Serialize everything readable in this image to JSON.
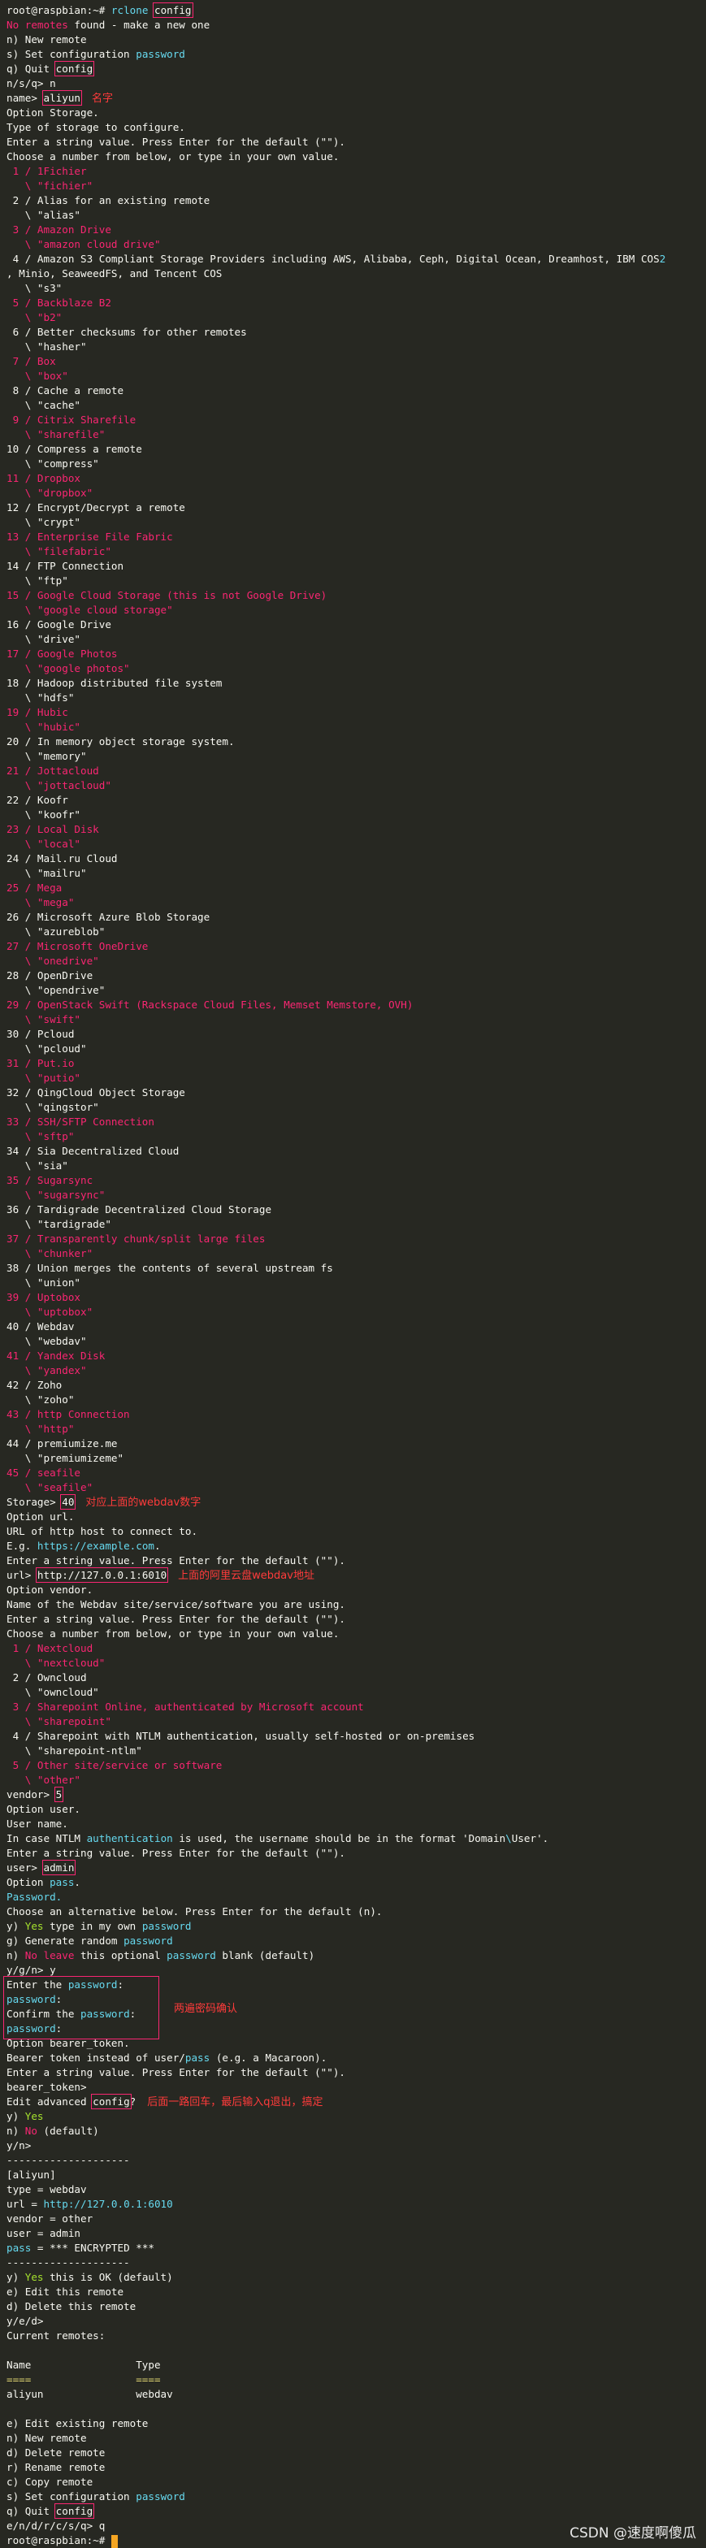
{
  "terminal": {
    "lines": [
      [
        {
          "t": "root@raspbian:~# "
        },
        {
          "t": "rclone",
          "c": "cy"
        },
        {
          "t": " "
        },
        {
          "t": "config",
          "bx": true
        }
      ],
      [
        {
          "t": "No remotes",
          "c": "rd"
        },
        {
          "t": " found - make a new one"
        }
      ],
      [
        {
          "t": "n) New remote"
        }
      ],
      [
        {
          "t": "s) Set configuration "
        },
        {
          "t": "password",
          "c": "cy"
        }
      ],
      [
        {
          "t": "q) Quit "
        },
        {
          "t": "config",
          "bx": true
        }
      ],
      [
        {
          "t": "n/s/q> n"
        }
      ],
      [
        {
          "t": "name> "
        },
        {
          "t": "aliyun",
          "bx": true
        },
        {
          "t": "名字",
          "note": true
        }
      ],
      [
        {
          "t": "Option Storage."
        }
      ],
      [
        {
          "t": "Type of storage to configure."
        }
      ],
      [
        {
          "t": "Enter a string value. Press Enter for the default (\"\")."
        }
      ],
      [
        {
          "t": "Choose a number from below, or type in your own value."
        }
      ],
      [
        {
          "t": " 1 / 1Fichier",
          "c": "rd"
        }
      ],
      [
        {
          "t": "   \\ \"fichier\"",
          "c": "rd"
        }
      ],
      [
        {
          "t": " 2 / Alias for an existing remote"
        }
      ],
      [
        {
          "t": "   \\ \"alias\""
        }
      ],
      [
        {
          "t": " 3 / Amazon Drive",
          "c": "rd"
        }
      ],
      [
        {
          "t": "   \\ \"amazon cloud drive\"",
          "c": "rd"
        }
      ],
      [
        {
          "t": " 4 / Amazon S3 Compliant Storage Providers including AWS, Alibaba, Ceph, Digital Ocean, Dreamhost, IBM COS"
        },
        {
          "t": "2",
          "c": "cy"
        }
      ],
      [
        {
          "t": ", Minio, SeaweedFS, and Tencent COS"
        }
      ],
      [
        {
          "t": "   \\ \"s3\""
        }
      ],
      [
        {
          "t": " 5 / Backblaze B2",
          "c": "rd"
        }
      ],
      [
        {
          "t": "   \\ \"b2\"",
          "c": "rd"
        }
      ],
      [
        {
          "t": " 6 / Better checksums for other remotes"
        }
      ],
      [
        {
          "t": "   \\ \"hasher\""
        }
      ],
      [
        {
          "t": " 7 / Box",
          "c": "rd"
        }
      ],
      [
        {
          "t": "   \\ \"box\"",
          "c": "rd"
        }
      ],
      [
        {
          "t": " 8 / Cache a remote"
        }
      ],
      [
        {
          "t": "   \\ \"cache\""
        }
      ],
      [
        {
          "t": " 9 / Citrix Sharefile",
          "c": "rd"
        }
      ],
      [
        {
          "t": "   \\ \"sharefile\"",
          "c": "rd"
        }
      ],
      [
        {
          "t": "10 / Compress a remote"
        }
      ],
      [
        {
          "t": "   \\ \"compress\""
        }
      ],
      [
        {
          "t": "11 / Dropbox",
          "c": "rd"
        }
      ],
      [
        {
          "t": "   \\ \"dropbox\"",
          "c": "rd"
        }
      ],
      [
        {
          "t": "12 / Encrypt/Decrypt a remote"
        }
      ],
      [
        {
          "t": "   \\ \"crypt\""
        }
      ],
      [
        {
          "t": "13 / Enterprise File Fabric",
          "c": "rd"
        }
      ],
      [
        {
          "t": "   \\ \"filefabric\"",
          "c": "rd"
        }
      ],
      [
        {
          "t": "14 / FTP Connection"
        }
      ],
      [
        {
          "t": "   \\ \"ftp\""
        }
      ],
      [
        {
          "t": "15 / Google Cloud Storage (this is not Google Drive)",
          "c": "rd"
        }
      ],
      [
        {
          "t": "   \\ \"google cloud storage\"",
          "c": "rd"
        }
      ],
      [
        {
          "t": "16 / Google Drive"
        }
      ],
      [
        {
          "t": "   \\ \"drive\""
        }
      ],
      [
        {
          "t": "17 / Google Photos",
          "c": "rd"
        }
      ],
      [
        {
          "t": "   \\ \"google photos\"",
          "c": "rd"
        }
      ],
      [
        {
          "t": "18 / Hadoop distributed file system"
        }
      ],
      [
        {
          "t": "   \\ \"hdfs\""
        }
      ],
      [
        {
          "t": "19 / Hubic",
          "c": "rd"
        }
      ],
      [
        {
          "t": "   \\ \"hubic\"",
          "c": "rd"
        }
      ],
      [
        {
          "t": "20 / In memory object storage system."
        }
      ],
      [
        {
          "t": "   \\ \"memory\""
        }
      ],
      [
        {
          "t": "21 / Jottacloud",
          "c": "rd"
        }
      ],
      [
        {
          "t": "   \\ \"jottacloud\"",
          "c": "rd"
        }
      ],
      [
        {
          "t": "22 / Koofr"
        }
      ],
      [
        {
          "t": "   \\ \"koofr\""
        }
      ],
      [
        {
          "t": "23 / Local Disk",
          "c": "rd"
        }
      ],
      [
        {
          "t": "   \\ \"local\"",
          "c": "rd"
        }
      ],
      [
        {
          "t": "24 / Mail.ru Cloud"
        }
      ],
      [
        {
          "t": "   \\ \"mailru\""
        }
      ],
      [
        {
          "t": "25 / Mega",
          "c": "rd"
        }
      ],
      [
        {
          "t": "   \\ \"mega\"",
          "c": "rd"
        }
      ],
      [
        {
          "t": "26 / Microsoft Azure Blob Storage"
        }
      ],
      [
        {
          "t": "   \\ \"azureblob\""
        }
      ],
      [
        {
          "t": "27 / Microsoft OneDrive",
          "c": "rd"
        }
      ],
      [
        {
          "t": "   \\ \"onedrive\"",
          "c": "rd"
        }
      ],
      [
        {
          "t": "28 / OpenDrive"
        }
      ],
      [
        {
          "t": "   \\ \"opendrive\""
        }
      ],
      [
        {
          "t": "29 / OpenStack Swift (Rackspace Cloud Files, Memset Memstore, OVH)",
          "c": "rd"
        }
      ],
      [
        {
          "t": "   \\ \"swift\"",
          "c": "rd"
        }
      ],
      [
        {
          "t": "30 / Pcloud"
        }
      ],
      [
        {
          "t": "   \\ \"pcloud\""
        }
      ],
      [
        {
          "t": "31 / Put.io",
          "c": "rd"
        }
      ],
      [
        {
          "t": "   \\ \"putio\"",
          "c": "rd"
        }
      ],
      [
        {
          "t": "32 / QingCloud Object Storage"
        }
      ],
      [
        {
          "t": "   \\ \"qingstor\""
        }
      ],
      [
        {
          "t": "33 / SSH/SFTP Connection",
          "c": "rd"
        }
      ],
      [
        {
          "t": "   \\ \"sftp\"",
          "c": "rd"
        }
      ],
      [
        {
          "t": "34 / Sia Decentralized Cloud"
        }
      ],
      [
        {
          "t": "   \\ \"sia\""
        }
      ],
      [
        {
          "t": "35 / Sugarsync",
          "c": "rd"
        }
      ],
      [
        {
          "t": "   \\ \"sugarsync\"",
          "c": "rd"
        }
      ],
      [
        {
          "t": "36 / Tardigrade Decentralized Cloud Storage"
        }
      ],
      [
        {
          "t": "   \\ \"tardigrade\""
        }
      ],
      [
        {
          "t": "37 / Transparently chunk/split large files",
          "c": "rd"
        }
      ],
      [
        {
          "t": "   \\ \"chunker\"",
          "c": "rd"
        }
      ],
      [
        {
          "t": "38 / Union merges the contents of several upstream fs"
        }
      ],
      [
        {
          "t": "   \\ \"union\""
        }
      ],
      [
        {
          "t": "39 / Uptobox",
          "c": "rd"
        }
      ],
      [
        {
          "t": "   \\ \"uptobox\"",
          "c": "rd"
        }
      ],
      [
        {
          "t": "40 / Webdav"
        }
      ],
      [
        {
          "t": "   \\ \"webdav\""
        }
      ],
      [
        {
          "t": "41 / Yandex Disk",
          "c": "rd"
        }
      ],
      [
        {
          "t": "   \\ \"yandex\"",
          "c": "rd"
        }
      ],
      [
        {
          "t": "42 / Zoho"
        }
      ],
      [
        {
          "t": "   \\ \"zoho\""
        }
      ],
      [
        {
          "t": "43 / http Connection",
          "c": "rd"
        }
      ],
      [
        {
          "t": "   \\ \"http\"",
          "c": "rd"
        }
      ],
      [
        {
          "t": "44 / premiumize.me"
        }
      ],
      [
        {
          "t": "   \\ \"premiumizeme\""
        }
      ],
      [
        {
          "t": "45 / seafile",
          "c": "rd"
        }
      ],
      [
        {
          "t": "   \\ \"seafile\"",
          "c": "rd"
        }
      ],
      [
        {
          "t": "Storage> "
        },
        {
          "t": "40",
          "bx": true
        },
        {
          "t": "对应上面的webdav数字",
          "note": true
        }
      ],
      [
        {
          "t": "Option url."
        }
      ],
      [
        {
          "t": "URL of http host to connect to."
        }
      ],
      [
        {
          "t": "E.g. "
        },
        {
          "t": "https://example.com",
          "c": "cy"
        },
        {
          "t": "."
        }
      ],
      [
        {
          "t": "Enter a string value. Press Enter for the default (\"\")."
        }
      ],
      [
        {
          "t": "url> "
        },
        {
          "t": "http://127.0.0.1:6010",
          "bx": true
        },
        {
          "t": "上面的阿里云盘webdav地址",
          "note": true
        }
      ],
      [
        {
          "t": "Option vendor."
        }
      ],
      [
        {
          "t": "Name of the Webdav site/service/software you are using."
        }
      ],
      [
        {
          "t": "Enter a string value. Press Enter for the default (\"\")."
        }
      ],
      [
        {
          "t": "Choose a number from below, or type in your own value."
        }
      ],
      [
        {
          "t": " 1 / Nextcloud",
          "c": "rd"
        }
      ],
      [
        {
          "t": "   \\ \"nextcloud\"",
          "c": "rd"
        }
      ],
      [
        {
          "t": " 2 / Owncloud"
        }
      ],
      [
        {
          "t": "   \\ \"owncloud\""
        }
      ],
      [
        {
          "t": " 3 / Sharepoint Online, authenticated by Microsoft account",
          "c": "rd"
        }
      ],
      [
        {
          "t": "   \\ \"sharepoint\"",
          "c": "rd"
        }
      ],
      [
        {
          "t": " 4 / Sharepoint with NTLM authentication, usually self-hosted or on-premises"
        }
      ],
      [
        {
          "t": "   \\ \"sharepoint-ntlm\""
        }
      ],
      [
        {
          "t": " 5 / Other site/service or software",
          "c": "rd"
        }
      ],
      [
        {
          "t": "   \\ \"other\"",
          "c": "rd"
        }
      ],
      [
        {
          "t": "vendor> "
        },
        {
          "t": "5",
          "bx": true
        }
      ],
      [
        {
          "t": "Option user."
        }
      ],
      [
        {
          "t": "User name."
        }
      ],
      [
        {
          "t": "In case NTLM "
        },
        {
          "t": "authentication",
          "c": "cy"
        },
        {
          "t": " is used, the username should be in the format 'Domain"
        },
        {
          "t": "\\",
          "c": "cy"
        },
        {
          "t": "User'."
        }
      ],
      [
        {
          "t": "Enter a string value. Press Enter for the default (\"\")."
        }
      ],
      [
        {
          "t": "user> "
        },
        {
          "t": "admin",
          "bx": true
        }
      ],
      [
        {
          "t": "Option "
        },
        {
          "t": "pass",
          "c": "cy"
        },
        {
          "t": "."
        }
      ],
      [
        {
          "t": "Password.",
          "c": "cy"
        }
      ],
      [
        {
          "t": "Choose an alternative below. Press Enter for the default (n)."
        }
      ],
      [
        {
          "t": "y) "
        },
        {
          "t": "Yes",
          "c": "gr"
        },
        {
          "t": " type in my own "
        },
        {
          "t": "password",
          "c": "cy"
        }
      ],
      [
        {
          "t": "g) Generate random "
        },
        {
          "t": "password",
          "c": "cy"
        }
      ],
      [
        {
          "t": "n) "
        },
        {
          "t": "No",
          "c": "rd"
        },
        {
          "t": " "
        },
        {
          "t": "leave",
          "c": "rd"
        },
        {
          "t": " this optional "
        },
        {
          "t": "password",
          "c": "cy"
        },
        {
          "t": " blank (default)"
        }
      ],
      [
        {
          "t": "y/g/n> y"
        }
      ],
      [
        {
          "t": "Enter the "
        },
        {
          "t": "password",
          "c": "cy"
        },
        {
          "t": ":"
        }
      ],
      [
        {
          "t": "password",
          "c": "cy"
        },
        {
          "t": ":"
        }
      ],
      [
        {
          "t": "Confirm the "
        },
        {
          "t": "password",
          "c": "cy"
        },
        {
          "t": ":"
        }
      ],
      [
        {
          "t": "password",
          "c": "cy"
        },
        {
          "t": ":"
        }
      ],
      [
        {
          "t": "Option bearer_token."
        }
      ],
      [
        {
          "t": "Bearer token instead of user/"
        },
        {
          "t": "pass",
          "c": "cy"
        },
        {
          "t": " (e.g. a Macaroon)."
        }
      ],
      [
        {
          "t": "Enter a string value. Press Enter for the default (\"\")."
        }
      ],
      [
        {
          "t": "bearer_token>"
        }
      ],
      [
        {
          "t": "Edit advanced "
        },
        {
          "t": "config",
          "bx": true
        },
        {
          "t": "?"
        },
        {
          "t": "后面一路回车，最后输入q退出，搞定",
          "note": true
        }
      ],
      [
        {
          "t": "y) "
        },
        {
          "t": "Yes",
          "c": "gr"
        }
      ],
      [
        {
          "t": "n) "
        },
        {
          "t": "No",
          "c": "rd"
        },
        {
          "t": " (default)"
        }
      ],
      [
        {
          "t": "y/n>"
        }
      ],
      [
        {
          "t": "--------------------"
        }
      ],
      [
        {
          "t": "[aliyun]"
        }
      ],
      [
        {
          "t": "type = webdav"
        }
      ],
      [
        {
          "t": "url = "
        },
        {
          "t": "http://127.0.0.1:6010",
          "c": "cy"
        }
      ],
      [
        {
          "t": "vendor = other"
        }
      ],
      [
        {
          "t": "user = admin"
        }
      ],
      [
        {
          "t": "pass",
          "c": "cy"
        },
        {
          "t": " = *** ENCRYPTED ***"
        }
      ],
      [
        {
          "t": "--------------------"
        }
      ],
      [
        {
          "t": "y) "
        },
        {
          "t": "Yes",
          "c": "gr"
        },
        {
          "t": " this is OK (default)"
        }
      ],
      [
        {
          "t": "e) Edit this remote"
        }
      ],
      [
        {
          "t": "d) Delete this remote"
        }
      ],
      [
        {
          "t": "y/e/d>"
        }
      ],
      [
        {
          "t": "Current remotes:"
        }
      ],
      [
        {
          "t": ""
        }
      ],
      [
        {
          "t": "Name                 Type"
        }
      ],
      [
        {
          "t": "====                 ====",
          "c": "yl"
        }
      ],
      [
        {
          "t": "aliyun               webdav"
        }
      ],
      [
        {
          "t": ""
        }
      ],
      [
        {
          "t": "e) Edit existing remote"
        }
      ],
      [
        {
          "t": "n) New remote"
        }
      ],
      [
        {
          "t": "d) Delete remote"
        }
      ],
      [
        {
          "t": "r) Rename remote"
        }
      ],
      [
        {
          "t": "c) Copy remote"
        }
      ],
      [
        {
          "t": "s) Set configuration "
        },
        {
          "t": "password",
          "c": "cy"
        }
      ],
      [
        {
          "t": "q) Quit "
        },
        {
          "t": "config",
          "bx": true
        }
      ],
      [
        {
          "t": "e/n/d/r/c/s/q> q"
        }
      ],
      [
        {
          "t": "root@raspbian:~# "
        },
        {
          "t": "",
          "cursor": true
        }
      ]
    ]
  },
  "password_annotation": {
    "note": "两遍密码确认"
  },
  "watermark": "CSDN @速度啊傻瓜",
  "colors": {
    "background": "#272822",
    "foreground": "#f8f8f2",
    "pink": "#f92672",
    "cyan": "#66d9ef",
    "yellow": "#e6db74",
    "green": "#a6e22e",
    "annotation": "#ff3b3b",
    "cursor": "#f5a623"
  }
}
